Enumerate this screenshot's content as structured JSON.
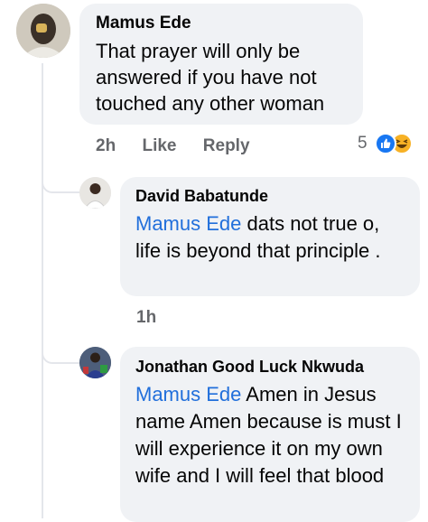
{
  "comments": [
    {
      "author": "Mamus Ede",
      "text": "That prayer will only be answered if you have not touched any other woman",
      "time": "2h",
      "like_label": "Like",
      "reply_label": "Reply",
      "reaction_count": "5",
      "reaction_icons": [
        "like-icon",
        "haha-icon"
      ]
    }
  ],
  "replies": [
    {
      "author": "David Babatunde",
      "mention": "Mamus Ede",
      "text": " dats not true o, life is beyond that principle .",
      "time": "1h"
    },
    {
      "author": "Jonathan Good Luck Nkwuda",
      "mention": "Mamus Ede",
      "text": " Amen in Jesus name Amen because is must I will experience it on my own wife and I will feel that blood"
    }
  ],
  "colors": {
    "bubble": "#f0f2f5",
    "mention": "#216fdb",
    "meta": "#65676b",
    "like": "#1877f2",
    "haha": "#f7b125"
  }
}
